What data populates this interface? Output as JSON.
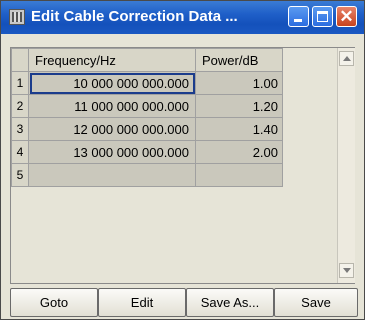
{
  "window": {
    "title": "Edit Cable Correction Data ..."
  },
  "table": {
    "headers": [
      "Frequency/Hz",
      "Power/dB"
    ],
    "rows": [
      {
        "index": "1",
        "frequency": "10 000 000 000.000",
        "power": "1.00"
      },
      {
        "index": "2",
        "frequency": "11 000 000 000.000",
        "power": "1.20"
      },
      {
        "index": "3",
        "frequency": "12 000 000 000.000",
        "power": "1.40"
      },
      {
        "index": "4",
        "frequency": "13 000 000 000.000",
        "power": "2.00"
      },
      {
        "index": "5",
        "frequency": "",
        "power": ""
      }
    ]
  },
  "buttons": {
    "goto": "Goto",
    "edit": "Edit",
    "save_as": "Save As...",
    "save": "Save"
  }
}
